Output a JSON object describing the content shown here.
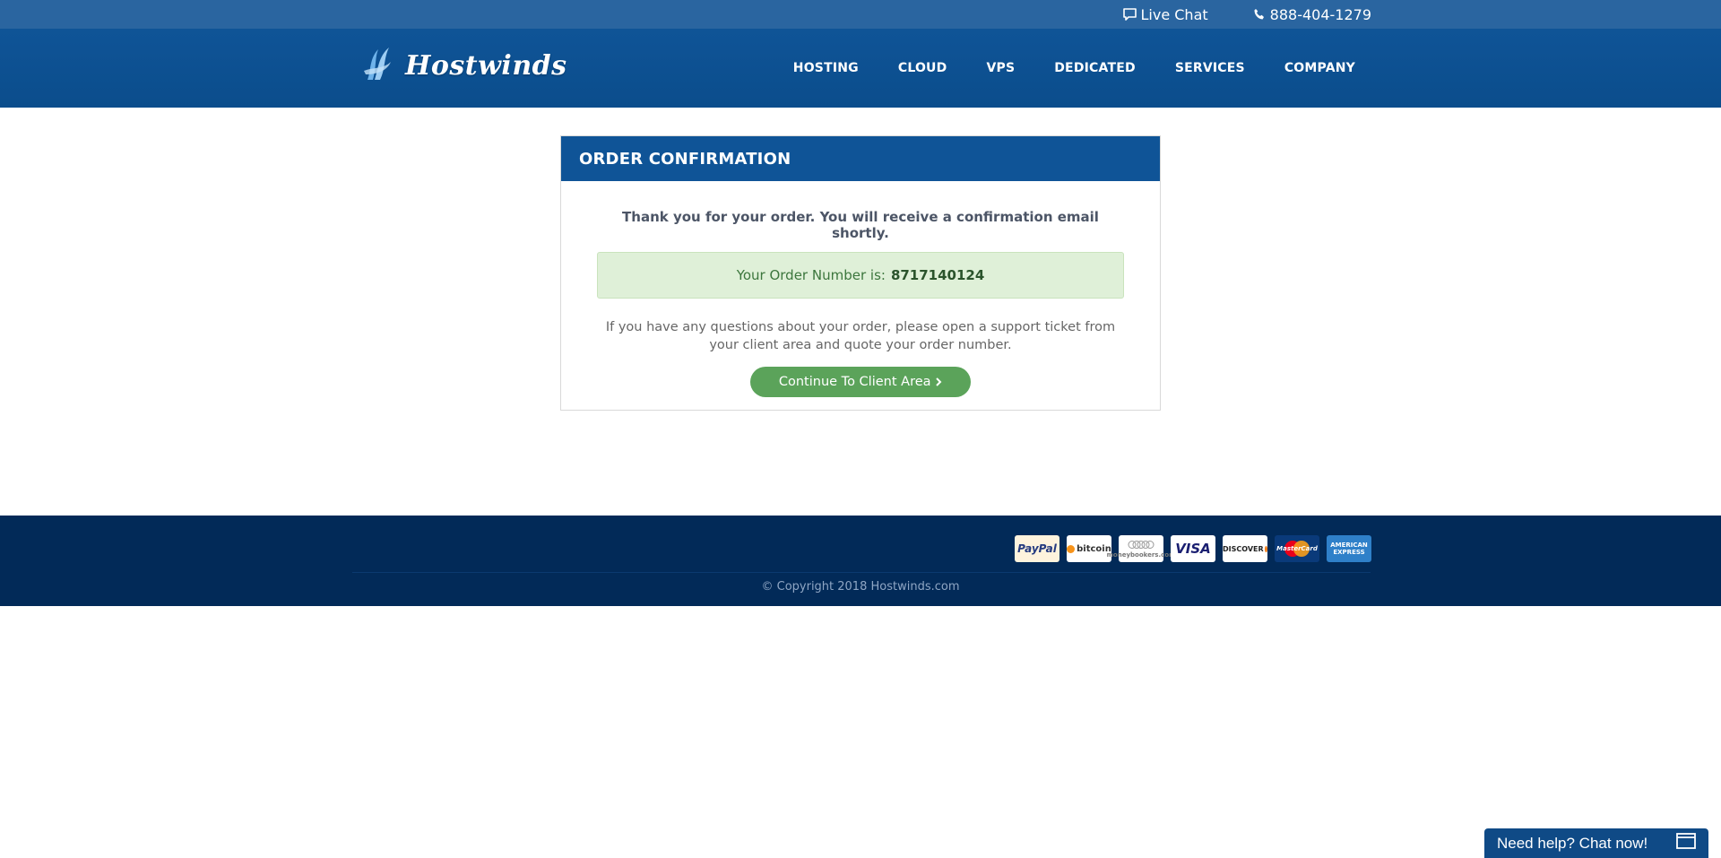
{
  "topbar": {
    "live_chat": "Live Chat",
    "phone": "888-404-1279"
  },
  "header": {
    "logo_text": "Hostwinds",
    "nav": [
      {
        "label": "HOSTING"
      },
      {
        "label": "CLOUD"
      },
      {
        "label": "VPS"
      },
      {
        "label": "DEDICATED"
      },
      {
        "label": "SERVICES"
      },
      {
        "label": "COMPANY"
      }
    ]
  },
  "order": {
    "title": "ORDER CONFIRMATION",
    "thanks": "Thank you for your order. You will receive a confirmation email shortly.",
    "order_label": "Your Order Number is:",
    "order_number": "8717140124",
    "note": "If you have any questions about your order, please open a support ticket from your client area and quote your order number.",
    "button_label": "Continue To Client Area"
  },
  "footer": {
    "payments": {
      "paypal": "PayPal",
      "bitcoin": "bitcoin",
      "moneybookers": "moneybookers.com",
      "visa": "VISA",
      "discover": "DISCOVER",
      "mastercard": "MasterCard",
      "amex_line1": "AMERICAN",
      "amex_line2": "EXPRESS"
    },
    "copyright": "© Copyright 2018 Hostwinds.com"
  },
  "chat_widget": {
    "label": "Need help? Chat now!"
  },
  "colors": {
    "topbar": "#2a65a0",
    "header": "#0f5497",
    "card_head": "#0f5497",
    "success_bg": "#dff0d8",
    "button": "#5ba35a",
    "footer": "#022a58"
  }
}
